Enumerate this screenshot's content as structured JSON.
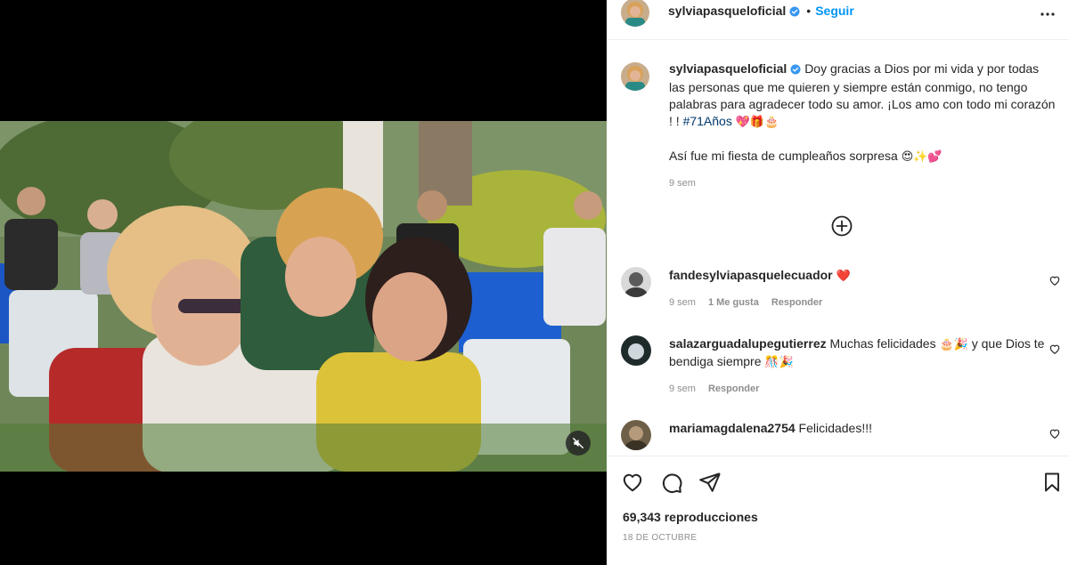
{
  "post": {
    "username": "sylviapasqueloficial",
    "follow_label": "Seguir",
    "separator": "•",
    "caption_text": "Doy gracias a Dios por mi vida y por todas las personas que me quieren y siempre están conmigo, no tengo palabras para agradecer todo su amor. ¡Los amo con todo mi corazón ! ! ",
    "caption_hashtag": "#71Años",
    "caption_emojis": "💖🎁🎂",
    "caption_line2": "Así fue mi fiesta de cumpleaños sorpresa",
    "caption_line2_emojis": "😍✨💕",
    "caption_time": "9 sem"
  },
  "comments": [
    {
      "username": "fandesylviapasquelecuador",
      "text": "",
      "emoji": "❤️",
      "time": "9 sem",
      "likes": "1 Me gusta",
      "reply": "Responder"
    },
    {
      "username": "salazarguadalupegutierrez",
      "text": "Muchas felicidades",
      "emoji_a": "🎂🎉",
      "text_b": "y que Dios te bendiga siempre",
      "emoji_b": "🎊🎉",
      "time": "9 sem",
      "reply": "Responder"
    },
    {
      "username": "mariamagdalena2754",
      "text": "Felicidades!!!"
    }
  ],
  "stats": {
    "views": "69,343 reproducciones",
    "date": "18 DE OCTUBRE"
  },
  "colors": {
    "accent": "#0095f6",
    "verified": "#3897f0",
    "hashtag": "#00376b",
    "muted": "#8e8e8e",
    "heart": "#ed4956"
  },
  "icons": [
    "verified-icon",
    "more-options-icon",
    "load-more-comments-icon",
    "like-icon",
    "comment-icon",
    "share-icon",
    "save-icon",
    "mute-icon"
  ]
}
